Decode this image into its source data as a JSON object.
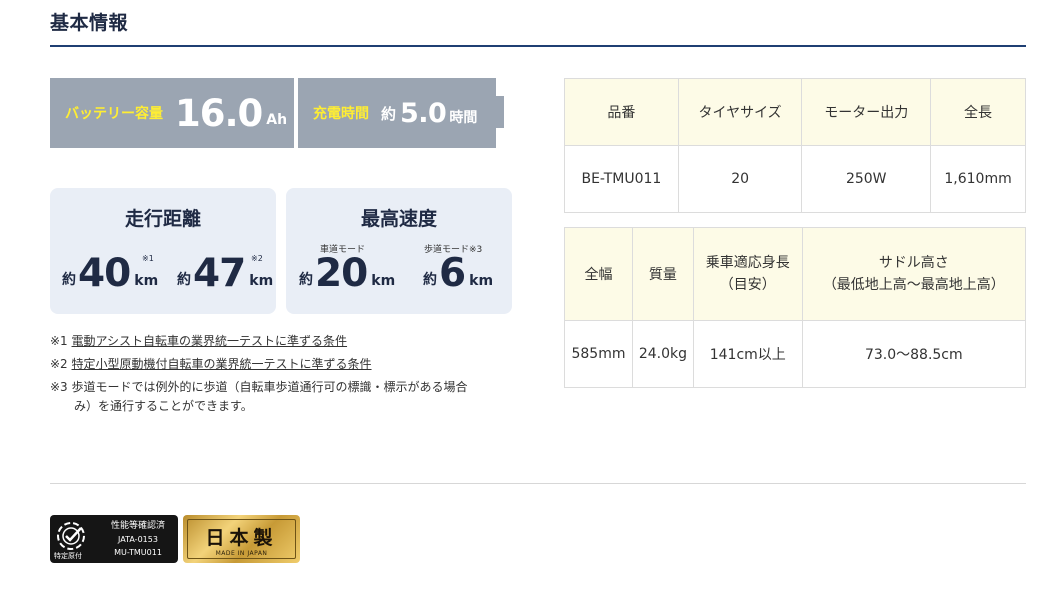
{
  "section_title": "基本情報",
  "battery": {
    "label": "バッテリー容量",
    "value": "16.0",
    "unit": "Ah"
  },
  "charge": {
    "label": "充電時間",
    "prefix": "約",
    "value": "5.0",
    "unit": "時間"
  },
  "distance": {
    "title": "走行距離",
    "items": [
      {
        "prefix": "約",
        "value": "40",
        "unit": "km",
        "note": "※1"
      },
      {
        "prefix": "約",
        "value": "47",
        "unit": "km",
        "note": "※2"
      }
    ]
  },
  "speed": {
    "title": "最高速度",
    "items": [
      {
        "label": "車道モード",
        "prefix": "約",
        "value": "20",
        "unit": "km"
      },
      {
        "label": "歩道モード※3",
        "prefix": "約",
        "value": "6",
        "unit": "km"
      }
    ]
  },
  "notes": [
    {
      "mark": "※1 ",
      "text": "電動アシスト自転車の業界統一テストに準ずる条件"
    },
    {
      "mark": "※2 ",
      "text": "特定小型原動機付自転車の業界統一テストに準ずる条件"
    },
    {
      "mark": "※3 ",
      "text": "歩道モードでは例外的に歩道（自転車歩道通行可の標識・標示がある場合"
    },
    {
      "mark": "",
      "text": "み）を通行することができます。"
    }
  ],
  "table1": {
    "headers": [
      "品番",
      "タイヤサイズ",
      "モーター出力",
      "全長"
    ],
    "values": [
      "BE-TMU011",
      "20",
      "250W",
      "1,610mm"
    ]
  },
  "table2": {
    "headers": [
      "全幅",
      "質量",
      "乗車適応身長",
      "（目安）",
      "サドル高さ",
      "（最低地上高〜最高地上高）"
    ],
    "values": [
      "585mm",
      "24.0kg",
      "141cm以上",
      "73.0〜88.5cm"
    ]
  },
  "badges": {
    "cert": {
      "lines": [
        "性能等確認済",
        "JATA-0153",
        "MU-TMU011"
      ],
      "small": "特定原付"
    },
    "japan": {
      "main": "日本製",
      "sub": "MADE IN JAPAN"
    }
  }
}
